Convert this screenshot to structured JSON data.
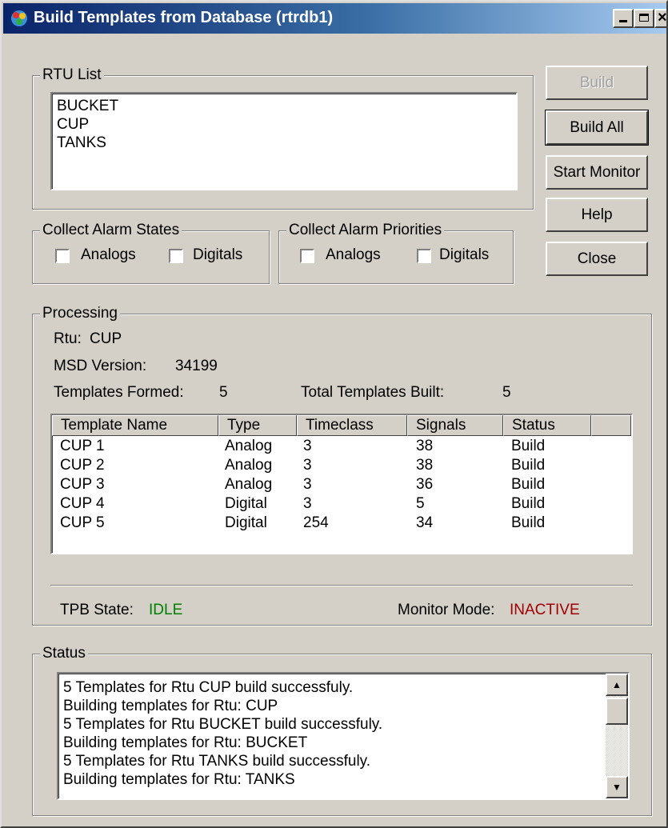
{
  "window": {
    "title": "Build Templates from Database  (rtrdb1)",
    "buttons": {
      "minimize_icon": "minimize-icon",
      "maximize_icon": "maximize-icon",
      "close_icon": "close-icon"
    }
  },
  "rtu_list": {
    "label": "RTU List",
    "items": [
      "BUCKET",
      "CUP",
      "TANKS"
    ]
  },
  "actions": {
    "build": "Build",
    "build_all": "Build All",
    "start_monitor": "Start Monitor",
    "help": "Help",
    "close": "Close"
  },
  "collect_alarm_states": {
    "label": "Collect Alarm States",
    "analogs": {
      "label": "Analogs",
      "checked": false
    },
    "digitals": {
      "label": "Digitals",
      "checked": false
    }
  },
  "collect_alarm_priorities": {
    "label": "Collect Alarm Priorities",
    "analogs": {
      "label": "Analogs",
      "checked": false
    },
    "digitals": {
      "label": "Digitals",
      "checked": false
    }
  },
  "processing": {
    "label": "Processing",
    "rtu_label": "Rtu:",
    "rtu_value": "CUP",
    "msd_label": "MSD Version:",
    "msd_value": "34199",
    "formed_label": "Templates Formed:",
    "formed_value": "5",
    "built_label": "Total Templates Built:",
    "built_value": "5",
    "table": {
      "headers": [
        "Template Name",
        "Type",
        "Timeclass",
        "Signals",
        "Status"
      ],
      "rows": [
        [
          "CUP 1",
          "Analog",
          "3",
          "38",
          "Build"
        ],
        [
          "CUP 2",
          "Analog",
          "3",
          "38",
          "Build"
        ],
        [
          "CUP 3",
          "Analog",
          "3",
          "36",
          "Build"
        ],
        [
          "CUP 4",
          "Digital",
          "3",
          "5",
          "Build"
        ],
        [
          "CUP 5",
          "Digital",
          "254",
          "34",
          "Build"
        ]
      ]
    },
    "tpb_state_label": "TPB State:",
    "tpb_state_value": "IDLE",
    "tpb_state_color": "#008000",
    "monitor_mode_label": "Monitor Mode:",
    "monitor_mode_value": "INACTIVE",
    "monitor_mode_color": "#a00000"
  },
  "status": {
    "label": "Status",
    "lines": [
      "5 Templates for Rtu CUP build successfuly.",
      "Building templates for Rtu: CUP",
      "5 Templates for Rtu BUCKET build successfuly.",
      "Building templates for Rtu: BUCKET",
      "5 Templates for Rtu TANKS build successfuly.",
      "Building templates for Rtu: TANKS"
    ],
    "scroll_up_icon": "scroll-up-arrow-icon",
    "scroll_down_icon": "scroll-down-arrow-icon"
  }
}
